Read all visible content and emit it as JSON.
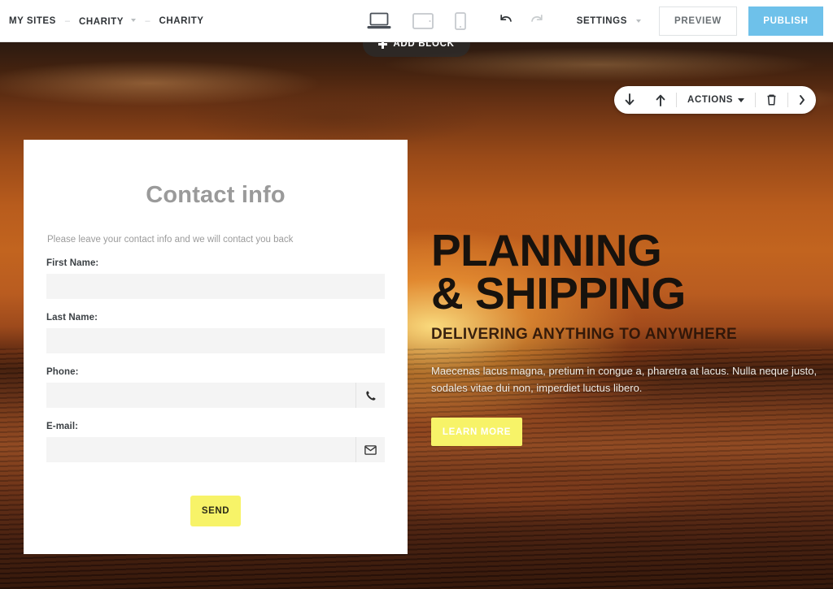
{
  "topbar": {
    "breadcrumb": [
      {
        "label": "MY SITES",
        "has_caret": false
      },
      {
        "label": "CHARITY",
        "has_caret": true
      },
      {
        "label": "CHARITY",
        "has_caret": false
      }
    ],
    "devices": [
      {
        "name": "desktop-view",
        "label": "Desktop",
        "active": true
      },
      {
        "name": "tablet-view",
        "label": "Tablet",
        "active": false
      },
      {
        "name": "mobile-view",
        "label": "Mobile",
        "active": false
      }
    ],
    "undo_label": "Undo",
    "redo_label": "Redo",
    "settings_label": "SETTINGS",
    "preview_label": "PREVIEW",
    "publish_label": "PUBLISH",
    "publish_color": "#6ec1ea"
  },
  "canvas": {
    "add_block_label": "ADD BLOCK",
    "actions": {
      "move_down_label": "Move down",
      "move_up_label": "Move up",
      "actions_label": "ACTIONS",
      "delete_label": "Delete",
      "more_label": "More"
    }
  },
  "contact_form": {
    "title": "Contact info",
    "subtitle": "Please leave your contact info and we will contact you back",
    "fields": [
      {
        "label": "First Name:",
        "value": "",
        "placeholder": "",
        "affix_icon": ""
      },
      {
        "label": "Last Name:",
        "value": "",
        "placeholder": "",
        "affix_icon": ""
      },
      {
        "label": "Phone:",
        "value": "",
        "placeholder": "",
        "affix_icon": "phone-icon"
      },
      {
        "label": "E-mail:",
        "value": "",
        "placeholder": "",
        "affix_icon": "envelope-icon"
      }
    ],
    "send_label": "SEND",
    "send_color": "#f7f368"
  },
  "hero": {
    "heading_line1": "PLANNING",
    "heading_line2": "& SHIPPING",
    "subheading": "DELIVERING ANYTHING TO ANYWHERE",
    "paragraph": "Maecenas lacus magna, pretium in congue a, pharetra at lacus. Nulla neque justo, sodales vitae dui non, imperdiet luctus libero.",
    "cta_label": "LEARN MORE",
    "cta_color": "#f7f368"
  }
}
